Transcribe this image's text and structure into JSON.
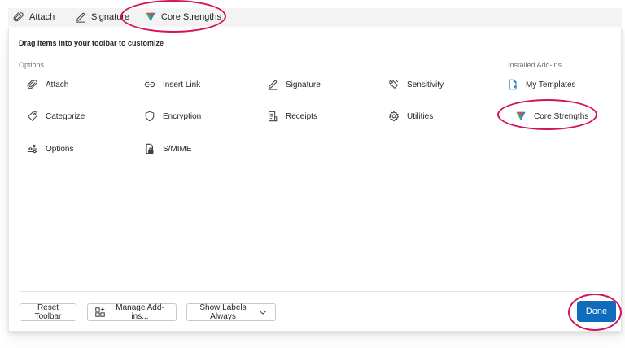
{
  "toolbar": {
    "items": [
      {
        "label": "Attach",
        "icon": "paperclip-icon"
      },
      {
        "label": "Signature",
        "icon": "pen-icon"
      },
      {
        "label": "Core Strengths",
        "icon": "core-strengths-logo-icon"
      }
    ]
  },
  "panel": {
    "title": "Drag items into your toolbar to customize",
    "options_label": "Options",
    "addins_label": "Installed Add-ins",
    "options": {
      "attach": "Attach",
      "insert_link": "Insert Link",
      "signature": "Signature",
      "sensitivity": "Sensitivity",
      "categorize": "Categorize",
      "encryption": "Encryption",
      "receipts": "Receipts",
      "utilities": "Utilities",
      "options": "Options",
      "smime": "S/MIME"
    },
    "addins": {
      "my_templates": "My Templates",
      "core_strengths": "Core Strengths"
    }
  },
  "footer": {
    "reset_label": "Reset Toolbar",
    "manage_label": "Manage Add-ins...",
    "show_labels_label": "Show Labels Always",
    "done_label": "Done"
  },
  "colors": {
    "accent": "#0f6cbd",
    "highlight_ring": "#d0135b",
    "logo_green": "#2bb673",
    "logo_red": "#e8434b",
    "logo_blue": "#2d7dd2"
  }
}
